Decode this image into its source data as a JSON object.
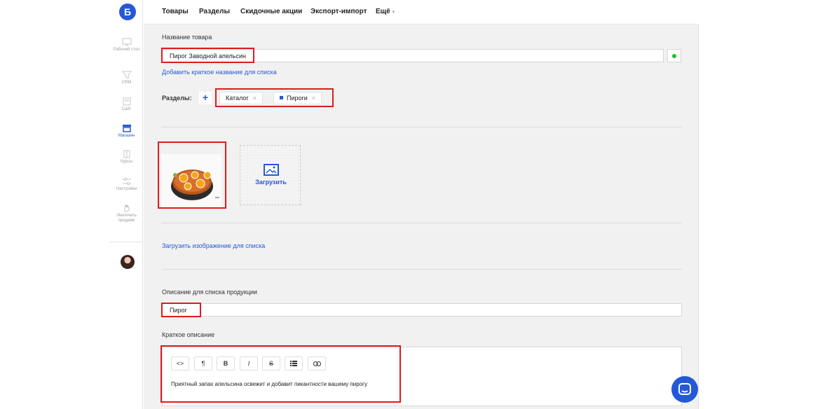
{
  "app": {
    "logo_letter": "Б"
  },
  "sidebar": {
    "items": [
      {
        "label": "Рабочий стол",
        "icon": "desktop-icon"
      },
      {
        "label": "CRM",
        "icon": "funnel-icon"
      },
      {
        "label": "Сайт",
        "icon": "site-icon"
      },
      {
        "label": "Магазин",
        "icon": "store-icon",
        "active": true
      },
      {
        "label": "Курсы",
        "icon": "courses-icon"
      },
      {
        "label": "Настройки",
        "icon": "sliders-icon"
      },
      {
        "label": "Увеличить продажи",
        "icon": "hand-icon"
      }
    ]
  },
  "topnav": {
    "items": [
      "Товары",
      "Разделы",
      "Скидочные акции",
      "Экспорт-импорт"
    ],
    "more_label": "Ещё",
    "more_chevron": "▾"
  },
  "form": {
    "product_name_label": "Название товара",
    "product_name_value": "Пирог Заводной апельсин",
    "short_name_link": "Добавить краткое название для списка",
    "sections_label": "Разделы:",
    "add_section_icon": "+",
    "sections": [
      "Каталог",
      "Пироги"
    ],
    "remove_glyph": "×",
    "upload_label": "Загрузить",
    "upload_list_image_link": "Загрузить изображение для списка",
    "list_description_label": "Описание для списка продукции",
    "list_description_value": "Пирог",
    "short_description_label": "Краткое описание",
    "editor_toolbar": [
      "<>",
      "¶",
      "B",
      "I",
      "S",
      "list",
      "link"
    ],
    "short_description_text": "Приятный запах апельсина освежит и добавит пикантности вашему пирогу"
  },
  "colors": {
    "accent": "#2459d6",
    "status_active": "#1bbf2e",
    "highlight": "#e01b1b"
  }
}
